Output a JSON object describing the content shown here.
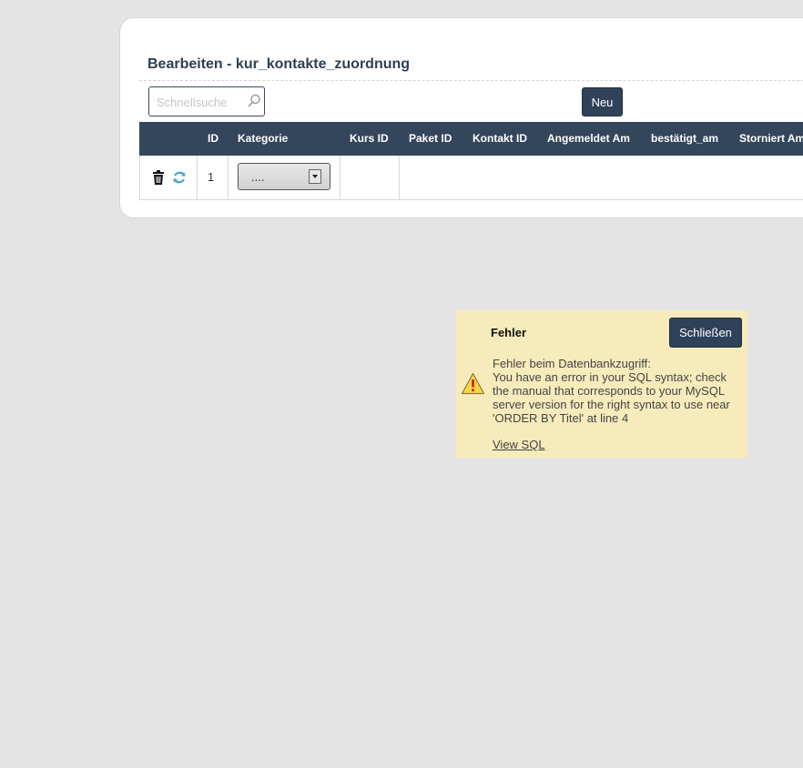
{
  "panel": {
    "title": "Bearbeiten - kur_kontakte_zuordnung",
    "search_placeholder": "Schnellsuche",
    "new_button_label": "Neu"
  },
  "grid": {
    "columns": [
      "ID",
      "Kategorie",
      "Kurs ID",
      "Paket ID",
      "Kontakt ID",
      "Angemeldet Am",
      "bestätigt_am",
      "Storniert Am"
    ],
    "rows": [
      {
        "id": "1",
        "kategorie": "...."
      }
    ]
  },
  "dialog": {
    "title": "Fehler",
    "close_label": "Schließen",
    "message_line1": "Fehler beim Datenbankzugriff:",
    "message_line2": "You have an error in your SQL syntax; check the manual that corresponds to your MySQL server version for the right syntax to use near 'ORDER BY Titel' at line 4",
    "view_sql_label": "View SQL"
  },
  "colors": {
    "background": "#e4e4e4",
    "header": "#34465c",
    "button": "#2f4259",
    "dialog_bg": "#f7ebbc"
  },
  "icons": [
    "search-icon",
    "trash-icon",
    "refresh-icon",
    "warning-icon",
    "chevron-down-icon"
  ]
}
